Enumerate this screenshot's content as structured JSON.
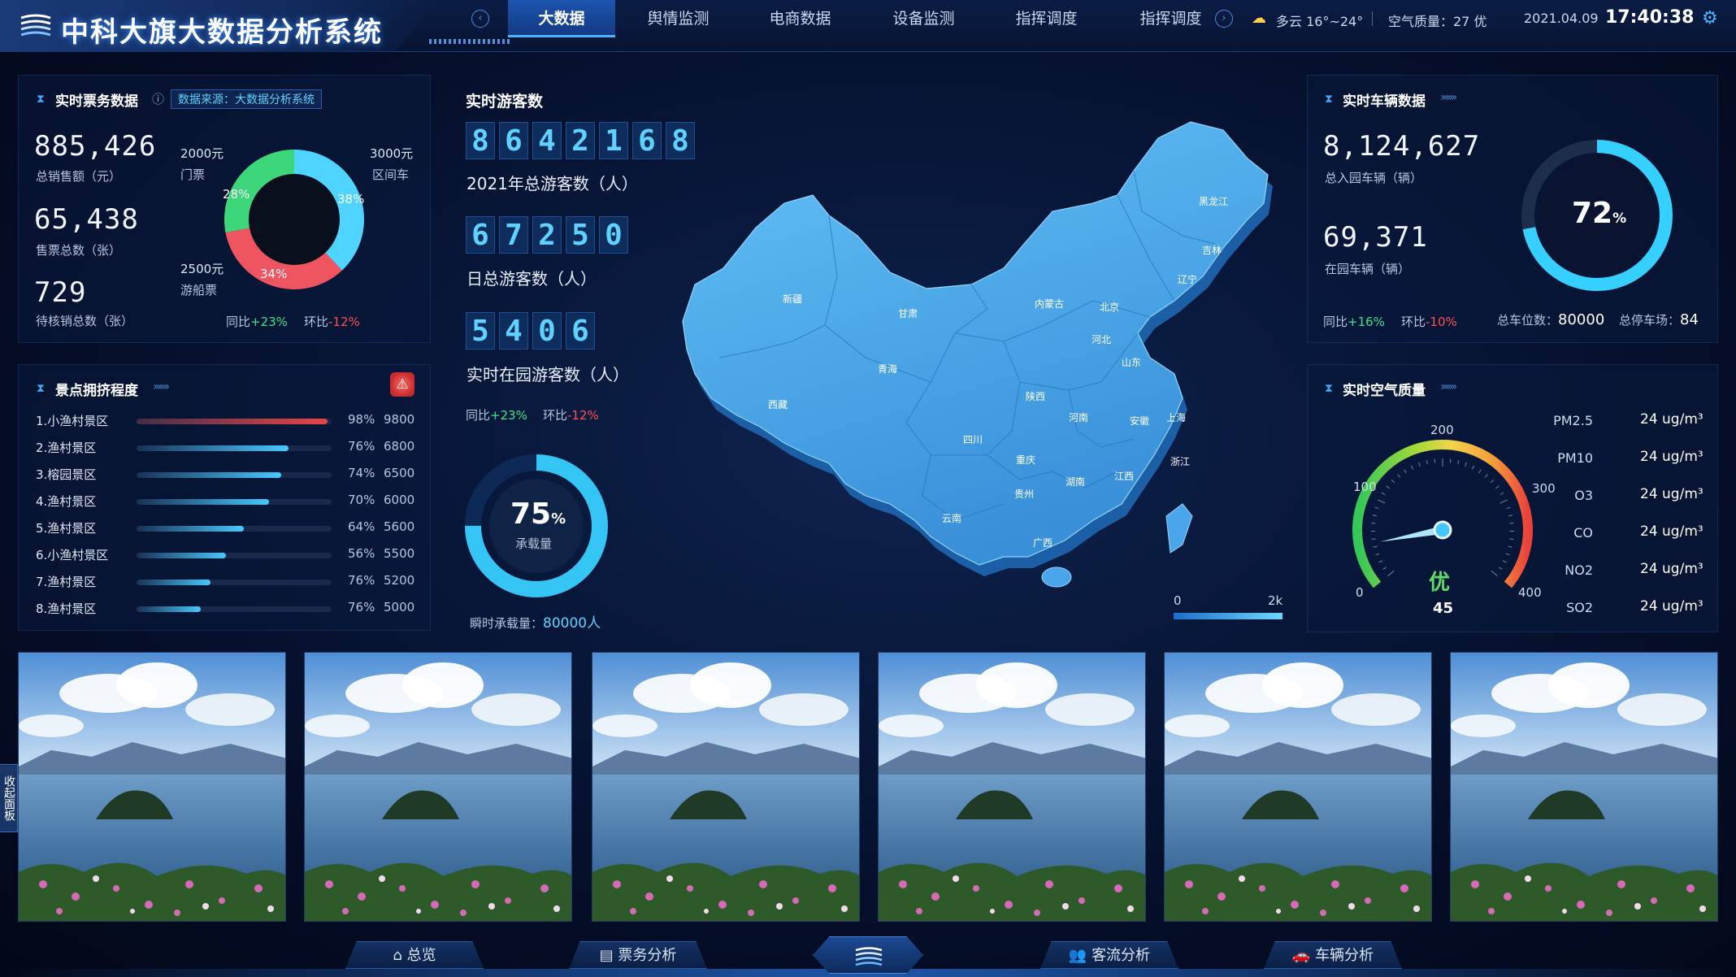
{
  "header": {
    "app_title": "中科大旗大数据分析系统",
    "tabs": [
      {
        "label": "大数据",
        "active": true
      },
      {
        "label": "舆情监测"
      },
      {
        "label": "电商数据"
      },
      {
        "label": "设备监测"
      },
      {
        "label": "指挥调度"
      },
      {
        "label": "指挥调度"
      }
    ],
    "weather": "多云 16°~24°",
    "air_quality": "空气质量：27 优",
    "date": "2021.04.09",
    "time": "17:40:38"
  },
  "ticket": {
    "title": "实时票务数据",
    "source": "数据来源：大数据分析系统",
    "stats": [
      {
        "value": "885,426",
        "label": "总销售额（元）"
      },
      {
        "value": "65,438",
        "label": "售票总数（张）"
      },
      {
        "value": "729",
        "label": "待核销总数（张）"
      }
    ],
    "donut": [
      {
        "name": "2000元",
        "sub": "门票",
        "pct": 28,
        "color": "#3dd67a"
      },
      {
        "name": "3000元",
        "sub": "区间车",
        "pct": 38,
        "color": "#4fd4ff"
      },
      {
        "name": "2500元",
        "sub": "游船票",
        "pct": 34,
        "color": "#ef5560"
      }
    ],
    "yoy_label": "同比",
    "yoy": "+23%",
    "mom_label": "环比",
    "mom": "-12%"
  },
  "crowd": {
    "title": "景点拥挤程度",
    "rows": [
      {
        "name": "1.小渔村景区",
        "pct": 98,
        "pct_label": "98%",
        "count": "9800"
      },
      {
        "name": "2.渔村景区",
        "pct": 76,
        "pct_label": "76%",
        "count": "6800"
      },
      {
        "name": "3.榕园景区",
        "pct": 74,
        "pct_label": "74%",
        "count": "6500"
      },
      {
        "name": "4.渔村景区",
        "pct": 70,
        "pct_label": "70%",
        "count": "6000"
      },
      {
        "name": "5.渔村景区",
        "pct": 64,
        "pct_label": "64%",
        "count": "5600"
      },
      {
        "name": "6.小渔村景区",
        "pct": 56,
        "pct_label": "56%",
        "count": "5500"
      },
      {
        "name": "7.渔村景区",
        "pct": 76,
        "pct_label": "76%",
        "count": "5200"
      },
      {
        "name": "8.渔村景区",
        "pct": 76,
        "pct_label": "76%",
        "count": "5000"
      }
    ]
  },
  "visitors": {
    "title": "实时游客数",
    "total_digits": "8642168",
    "total_label": "2021年总游客数（人）",
    "daily_digits": "67250",
    "daily_label": "日总游客数（人）",
    "inpark_digits": "5406",
    "inpark_label": "实时在园游客数（人）",
    "yoy_label": "同比",
    "yoy": "+23%",
    "mom_label": "环比",
    "mom": "-12%",
    "capacity_pct": 75,
    "capacity_num": "75",
    "capacity_unit": "%",
    "capacity_label": "承载量",
    "instant_label": "瞬时承载量：",
    "instant_value": "80000人"
  },
  "map": {
    "provinces": [
      "黑龙江",
      "吉林",
      "辽宁",
      "内蒙古",
      "北京",
      "河北",
      "山东",
      "新疆",
      "甘肃",
      "青海",
      "西藏",
      "陕西",
      "安徽",
      "上海",
      "四川",
      "河南",
      "浙江",
      "重庆",
      "湖南",
      "江西",
      "贵州",
      "云南",
      "广西"
    ],
    "legend_min": "0",
    "legend_max": "2k"
  },
  "vehicle": {
    "title": "实时车辆数据",
    "total": "8,124,627",
    "total_label": "总入园车辆（辆）",
    "inpark": "69,371",
    "inpark_label": "在园车辆（辆）",
    "pct": 72,
    "pct_num": "72",
    "pct_unit": "%",
    "yoy_label": "同比",
    "yoy": "+16%",
    "mom_label": "环比",
    "mom": "-10%",
    "spaces_label": "总车位数：",
    "spaces": "80000",
    "lots_label": "总停车场：",
    "lots": "84"
  },
  "air": {
    "title": "实时空气质量",
    "ticks": [
      "0",
      "100",
      "200",
      "300",
      "400"
    ],
    "level": "优",
    "value": 45,
    "value_text": "45",
    "items": [
      {
        "label": "PM2.5",
        "value": "24 ug/m³"
      },
      {
        "label": "PM10",
        "value": "24 ug/m³"
      },
      {
        "label": "O3",
        "value": "24 ug/m³"
      },
      {
        "label": "CO",
        "value": "24 ug/m³"
      },
      {
        "label": "NO2",
        "value": "24 ug/m³"
      },
      {
        "label": "SO2",
        "value": "24 ug/m³"
      }
    ]
  },
  "side_tab": "收起面板",
  "bottom_nav": [
    {
      "label": "总览",
      "icon": "home-icon"
    },
    {
      "label": "票务分析",
      "icon": "ticket-icon"
    },
    {
      "label": "客流分析",
      "icon": "people-icon"
    },
    {
      "label": "车辆分析",
      "icon": "car-icon"
    }
  ]
}
